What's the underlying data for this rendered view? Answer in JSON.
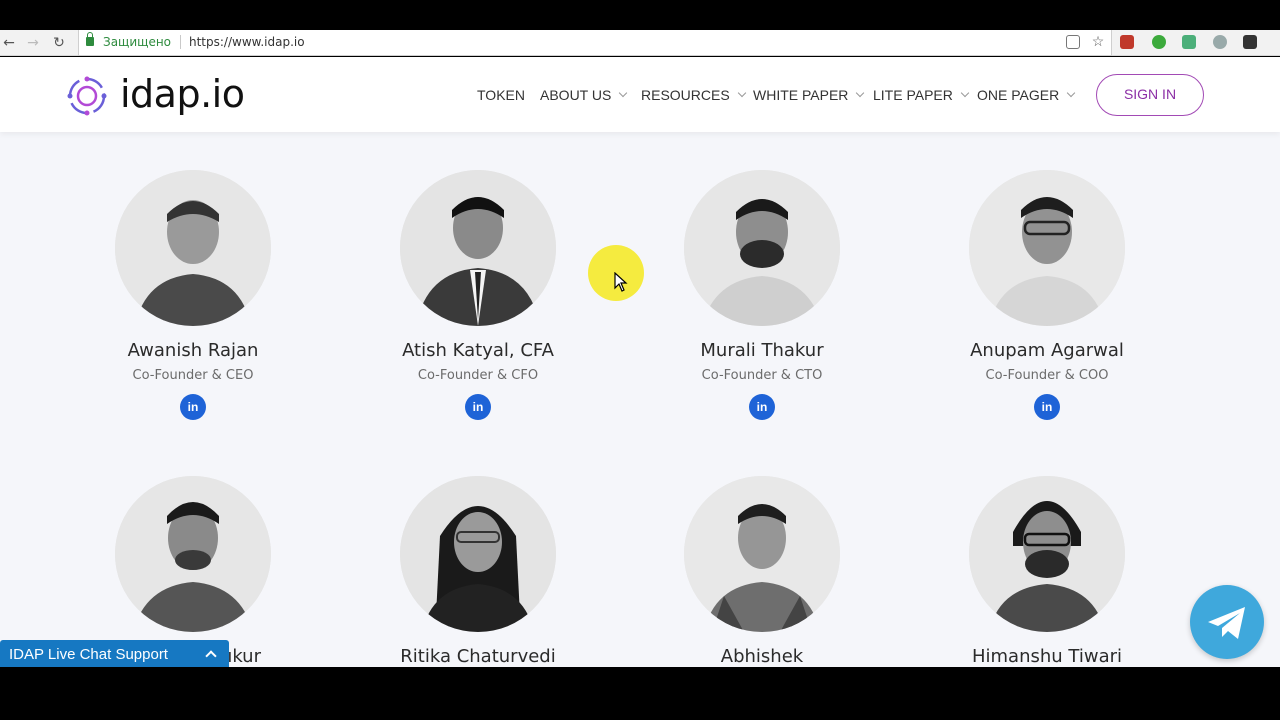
{
  "browser": {
    "secure_label": "Защищено",
    "url": "https://www.idap.io"
  },
  "header": {
    "logo_text": "idap.io",
    "menu": [
      {
        "label": "TOKEN",
        "dropdown": false
      },
      {
        "label": "ABOUT US",
        "dropdown": true
      },
      {
        "label": "RESOURCES",
        "dropdown": true
      },
      {
        "label": "WHITE PAPER",
        "dropdown": true
      },
      {
        "label": "LITE PAPER",
        "dropdown": true
      },
      {
        "label": "ONE PAGER",
        "dropdown": true
      }
    ],
    "signin_label": "SIGN IN"
  },
  "team": [
    {
      "name": "Awanish Rajan",
      "role": "Co-Founder & CEO",
      "social": "in"
    },
    {
      "name": "Atish Katyal, CFA",
      "role": "Co-Founder & CFO",
      "social": "in"
    },
    {
      "name": "Murali Thakur",
      "role": "Co-Founder & CTO",
      "social": "in"
    },
    {
      "name": "Anupam Agarwal",
      "role": "Co-Founder & COO",
      "social": "in"
    },
    {
      "name": "ıkur",
      "role": ""
    },
    {
      "name": "Ritika Chaturvedi",
      "role": ""
    },
    {
      "name": "Abhishek",
      "role": ""
    },
    {
      "name": "Himanshu Tiwari",
      "role": ""
    }
  ],
  "chat_widget": {
    "label": "IDAP Live Chat Support"
  },
  "colors": {
    "brand_purple": "#8c2fa6",
    "linkedin_blue": "#1e63d7",
    "chat_blue": "#1678c2",
    "telegram_blue": "#3fa8dc"
  },
  "icons": [
    "back-icon",
    "forward-icon",
    "reload-icon",
    "lock-icon",
    "translate-icon",
    "star-icon",
    "linkedin-icon",
    "telegram-icon",
    "chevron-up-icon"
  ]
}
